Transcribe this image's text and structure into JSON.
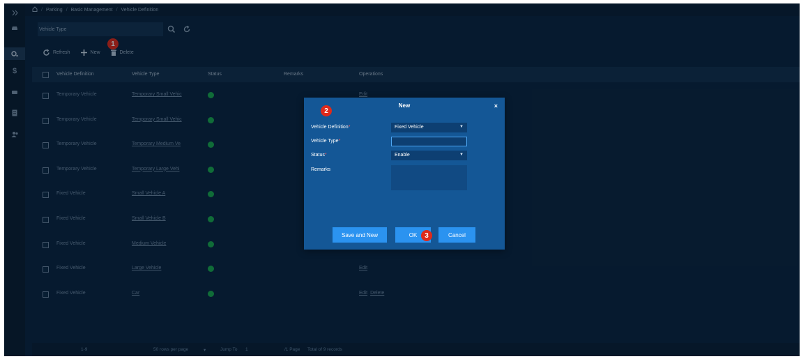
{
  "breadcrumb": [
    "Parking",
    "Basic Management",
    "Vehicle Definition"
  ],
  "filter": {
    "label": "Vehicle Type"
  },
  "toolbar": {
    "refresh": "Refresh",
    "new": "New",
    "delete": "Delete"
  },
  "table": {
    "headers": [
      "Vehicle Definition",
      "Vehicle Type",
      "Status",
      "Remarks",
      "Operations"
    ],
    "rows": [
      {
        "definition": "Temporary Vehicle",
        "type": "Temporary Small Vehic",
        "status": "enabled",
        "ops": [
          "Edit"
        ]
      },
      {
        "definition": "Temporary Vehicle",
        "type": "Temporary Small Vehic",
        "status": "enabled",
        "ops": []
      },
      {
        "definition": "Temporary Vehicle",
        "type": "Temporary Medium Ve",
        "status": "enabled",
        "ops": []
      },
      {
        "definition": "Temporary Vehicle",
        "type": "Temporary Large Vehi",
        "status": "enabled",
        "ops": []
      },
      {
        "definition": "Fixed Vehicle",
        "type": "Small Vehicle A",
        "status": "enabled",
        "ops": []
      },
      {
        "definition": "Fixed Vehicle",
        "type": "Small Vehicle B",
        "status": "enabled",
        "ops": []
      },
      {
        "definition": "Fixed Vehicle",
        "type": "Medium Vehicle",
        "status": "enabled",
        "ops": []
      },
      {
        "definition": "Fixed Vehicle",
        "type": "Large Vehicle",
        "status": "enabled",
        "ops": [
          "Edit"
        ]
      },
      {
        "definition": "Fixed Vehicle",
        "type": "Car",
        "status": "enabled",
        "ops": [
          "Edit",
          "Delete"
        ]
      }
    ]
  },
  "pagination": {
    "range": "1-9",
    "rows_per_page": "50 rows per page",
    "jump_to": "Jump To",
    "page_input": "1",
    "page_total": "/1 Page",
    "total": "Total of 9 records"
  },
  "modal": {
    "title": "New",
    "close": "×",
    "fields": {
      "definition_label": "Vehicle Definition",
      "definition_value": "Fixed Vehicle",
      "type_label": "Vehicle Type",
      "type_value": "",
      "status_label": "Status",
      "status_value": "Enable",
      "remarks_label": "Remarks",
      "required_mark": "*"
    },
    "buttons": {
      "save_new": "Save and New",
      "ok": "OK",
      "cancel": "Cancel"
    }
  },
  "annotations": [
    "1",
    "2",
    "3"
  ],
  "colors": {
    "accent": "#2b93f0",
    "badge": "#e02a1a",
    "status_ok": "#1aa84e"
  },
  "icons": {
    "rail": [
      "expand-icon",
      "car-icon",
      "settings-icon",
      "dollar-icon",
      "vehicle-icon",
      "report-icon",
      "people-icon"
    ],
    "home": "home-icon"
  }
}
